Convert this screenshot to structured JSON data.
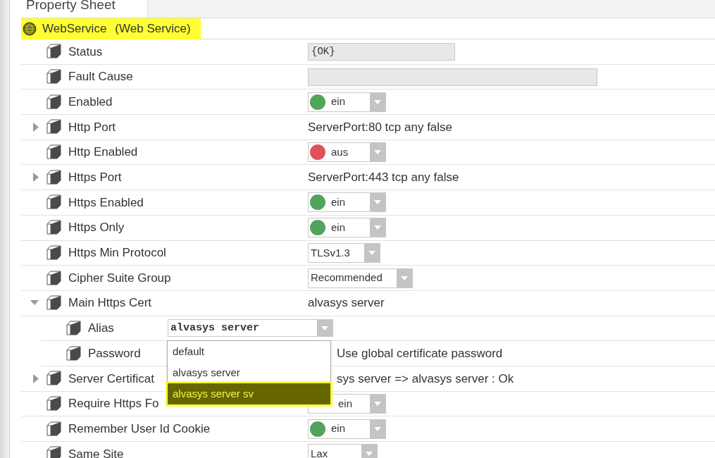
{
  "tab": {
    "label": "Property Sheet"
  },
  "component": {
    "name": "WebService",
    "type": "(Web Service)",
    "highlighted": true
  },
  "properties": [
    {
      "label": "Status",
      "value": {
        "kind": "short-field",
        "text": "{OK}"
      }
    },
    {
      "label": "Fault Cause",
      "value": {
        "kind": "long-field"
      }
    },
    {
      "label": "Enabled",
      "value": {
        "kind": "toggle",
        "text": "ein",
        "on": true
      }
    },
    {
      "label": "Http Port",
      "expanded": false,
      "value": {
        "kind": "text",
        "text": "ServerPort:80 tcp any false"
      }
    },
    {
      "label": "Http Enabled",
      "value": {
        "kind": "toggle",
        "text": "aus",
        "on": false
      }
    },
    {
      "label": "Https Port",
      "expanded": false,
      "value": {
        "kind": "text",
        "text": "ServerPort:443 tcp any false"
      }
    },
    {
      "label": "Https Enabled",
      "value": {
        "kind": "toggle",
        "text": "ein",
        "on": true
      }
    },
    {
      "label": "Https Only",
      "value": {
        "kind": "toggle",
        "text": "ein",
        "on": true
      }
    },
    {
      "label": "Https Min Protocol",
      "value": {
        "kind": "select",
        "text": "TLSv1.3"
      }
    },
    {
      "label": "Cipher Suite Group",
      "value": {
        "kind": "select",
        "text": "Recommended"
      }
    },
    {
      "label": "Main Https Cert",
      "expanded": true,
      "value": {
        "kind": "text",
        "text": "alvasys server"
      },
      "children": [
        {
          "label": "Alias",
          "value": {
            "kind": "combo",
            "text": "alvasys server"
          }
        },
        {
          "label": "Password",
          "value": {
            "kind": "covered-text",
            "text": "Use global certificate password"
          }
        }
      ]
    },
    {
      "label": "Server Certificat",
      "expanded": false,
      "value": {
        "kind": "covered-text",
        "text": "sys server => alvasys server : Ok"
      }
    },
    {
      "label": "Require Https Fo",
      "value": {
        "kind": "covered-toggle",
        "text": "ein"
      }
    },
    {
      "label": "Remember User Id Cookie",
      "value": {
        "kind": "toggle",
        "text": "ein",
        "on": true
      }
    },
    {
      "label": "Same Site",
      "value": {
        "kind": "select",
        "text": "Lax"
      }
    }
  ],
  "alias_dropdown": {
    "items": [
      {
        "label": "default",
        "selected": false
      },
      {
        "label": "alvasys server",
        "selected": false
      },
      {
        "label": "alvasys server sv",
        "selected": true
      }
    ]
  }
}
